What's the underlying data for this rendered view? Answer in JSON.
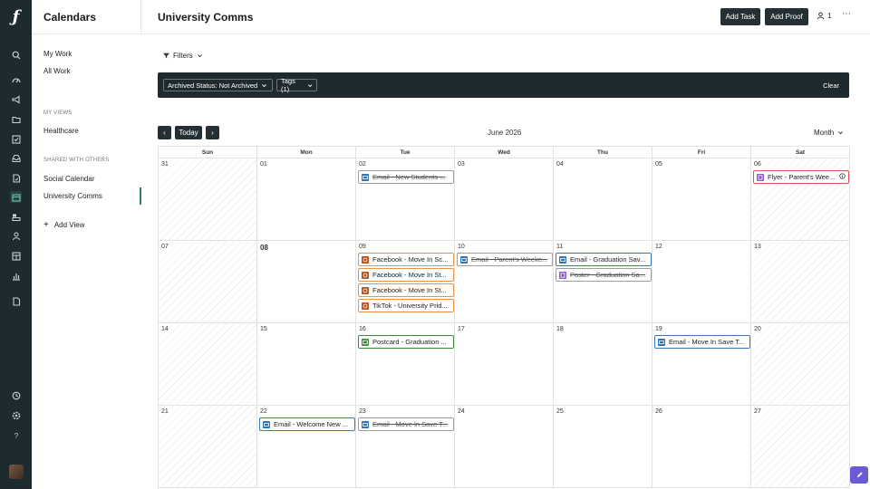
{
  "rail": {
    "items": [
      {
        "icon": "search-icon",
        "y": 0
      },
      {
        "icon": "dashboard-icon"
      },
      {
        "icon": "megaphone-icon"
      },
      {
        "icon": "folder-icon"
      },
      {
        "icon": "checklist-icon"
      },
      {
        "icon": "inbox-icon"
      },
      {
        "icon": "proof-icon"
      },
      {
        "icon": "calendar-icon"
      },
      {
        "icon": "workload-icon"
      },
      {
        "icon": "user-icon"
      },
      {
        "icon": "table-icon"
      },
      {
        "icon": "chart-icon"
      },
      {
        "icon": "document-icon"
      }
    ],
    "bottom": [
      {
        "icon": "clock-icon"
      },
      {
        "icon": "settings-icon"
      },
      {
        "icon": "help-icon"
      }
    ]
  },
  "sidebar": {
    "title": "Calendars",
    "my_work": "My Work",
    "all_work": "All Work",
    "my_views_heading": "MY VIEWS",
    "my_views": [
      "Healthcare"
    ],
    "shared_heading": "SHARED WITH OTHERS",
    "shared": [
      "Social Calendar",
      "University Comms"
    ],
    "add_view": "Add View"
  },
  "header": {
    "title": "University Comms",
    "add_task": "Add Task",
    "add_proof": "Add Proof",
    "member_count": "1",
    "more": "⋯"
  },
  "filters": {
    "toggle_label": "Filters",
    "chips": [
      "Archived Status: Not Archived",
      "Tags (1)"
    ],
    "clear": "Clear"
  },
  "calendar": {
    "today_label": "Today",
    "prev": "‹",
    "next": "›",
    "month_title": "June 2026",
    "view_mode": "Month",
    "weekdays": [
      "Sun",
      "Mon",
      "Tue",
      "Wed",
      "Thu",
      "Fri",
      "Sat"
    ],
    "weeks": [
      [
        {
          "day": "31",
          "muted": true
        },
        {
          "day": "01"
        },
        {
          "day": "02"
        },
        {
          "day": "03"
        },
        {
          "day": "04"
        },
        {
          "day": "05"
        },
        {
          "day": "06",
          "muted": true
        }
      ],
      [
        {
          "day": "07",
          "muted": true
        },
        {
          "day": "08",
          "today": true
        },
        {
          "day": "09"
        },
        {
          "day": "10"
        },
        {
          "day": "11"
        },
        {
          "day": "12"
        },
        {
          "day": "13",
          "muted": true
        }
      ],
      [
        {
          "day": "14",
          "muted": true
        },
        {
          "day": "15"
        },
        {
          "day": "16"
        },
        {
          "day": "17"
        },
        {
          "day": "18"
        },
        {
          "day": "19"
        },
        {
          "day": "20",
          "muted": true
        }
      ],
      [
        {
          "day": "21",
          "muted": true
        },
        {
          "day": "22"
        },
        {
          "day": "23"
        },
        {
          "day": "24"
        },
        {
          "day": "25"
        },
        {
          "day": "26"
        },
        {
          "day": "27",
          "muted": true
        }
      ]
    ],
    "events": [
      {
        "week": 0,
        "dow": 2,
        "slot": 0,
        "label": "Email - New Students ...",
        "kind": "email",
        "status": "done"
      },
      {
        "week": 0,
        "dow": 6,
        "slot": 0,
        "label": "Flyer - Parent's Wee...",
        "kind": "print",
        "status": "overdue",
        "info": true
      },
      {
        "week": 1,
        "dow": 2,
        "slot": 0,
        "label": "Facebook - Move In Sc...",
        "kind": "social",
        "status": "progress"
      },
      {
        "week": 1,
        "dow": 2,
        "slot": 1,
        "label": "Facebook - Move In St...",
        "kind": "social",
        "status": "progress"
      },
      {
        "week": 1,
        "dow": 2,
        "slot": 2,
        "label": "Facebook - Move In St...",
        "kind": "social",
        "status": "progress"
      },
      {
        "week": 1,
        "dow": 2,
        "slot": 3,
        "label": "TikTok - University Prid...",
        "kind": "social",
        "status": "progress"
      },
      {
        "week": 1,
        "dow": 3,
        "slot": 0,
        "label": "Email - Parent's Weeke...",
        "kind": "email",
        "status": "done"
      },
      {
        "week": 1,
        "dow": 4,
        "slot": 0,
        "label": "Email - Graduation Sav...",
        "kind": "email",
        "status": "open"
      },
      {
        "week": 1,
        "dow": 4,
        "slot": 1,
        "label": "Poster - Graduation Sa...",
        "kind": "print",
        "status": "done"
      },
      {
        "week": 2,
        "dow": 2,
        "slot": 0,
        "label": "Postcard - Graduation ...",
        "kind": "postcard",
        "status": "approved"
      },
      {
        "week": 2,
        "dow": 5,
        "slot": 0,
        "label": "Email - Move In Save T...",
        "kind": "email",
        "status": "open"
      },
      {
        "week": 3,
        "dow": 1,
        "slot": 0,
        "label": "Email - Welcome New ...",
        "kind": "email",
        "status": "open"
      },
      {
        "week": 3,
        "dow": 2,
        "slot": 0,
        "label": "Email - Move In Save T...",
        "kind": "email",
        "status": "done"
      }
    ]
  },
  "colors": {
    "rail_bg": "#1d2a2e",
    "dark_button": "#243033",
    "email": "#2f74b8",
    "print": "#8a5cc2",
    "social": "#b5521d",
    "postcard": "#3d8a3d",
    "border_open": "#3a78b8",
    "border_progress": "#e8924a",
    "border_overdue": "#d9534f",
    "border_approved": "#3d8a3d",
    "border_done": "#9e9e9e",
    "accent": "#2a7d6d",
    "help_fab": "#6b5ad6"
  }
}
